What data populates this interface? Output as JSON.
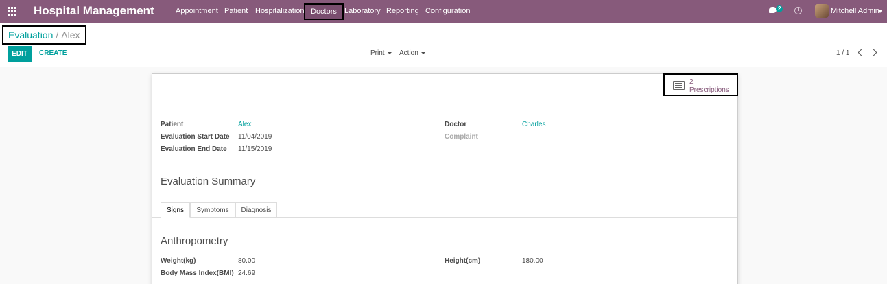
{
  "navbar": {
    "brand": "Hospital Management",
    "menu": [
      "Appointment",
      "Patient",
      "Hospitalization",
      "Doctors",
      "Laboratory",
      "Reporting",
      "Configuration"
    ],
    "chat_count": "2",
    "user_name": "Mitchell Admin",
    "color": "#875a7b"
  },
  "breadcrumb": {
    "parent": "Evaluation",
    "separator": "/",
    "current": "Alex"
  },
  "actions": {
    "edit": "EDIT",
    "create": "CREATE",
    "print": "Print",
    "action": "Action"
  },
  "pager": {
    "value": "1 / 1"
  },
  "smart_button": {
    "count": "2",
    "label": "Prescriptions",
    "icon": "list-icon"
  },
  "fields": {
    "patient_label": "Patient",
    "patient_value": "Alex",
    "start_label": "Evaluation Start Date",
    "start_value": "11/04/2019",
    "end_label": "Evaluation End Date",
    "end_value": "11/15/2019",
    "doctor_label": "Doctor",
    "doctor_value": "Charles",
    "complaint_label": "Complaint"
  },
  "summary_title": "Evaluation Summary",
  "tabs": [
    "Signs",
    "Symptoms",
    "Diagnosis"
  ],
  "anthropometry": {
    "title": "Anthropometry",
    "weight_label": "Weight(kg)",
    "weight_value": "80.00",
    "bmi_label": "Body Mass Index(BMI)",
    "bmi_value": "24.69",
    "height_label": "Height(cm)",
    "height_value": "180.00"
  },
  "accent_color": "#00a09d"
}
